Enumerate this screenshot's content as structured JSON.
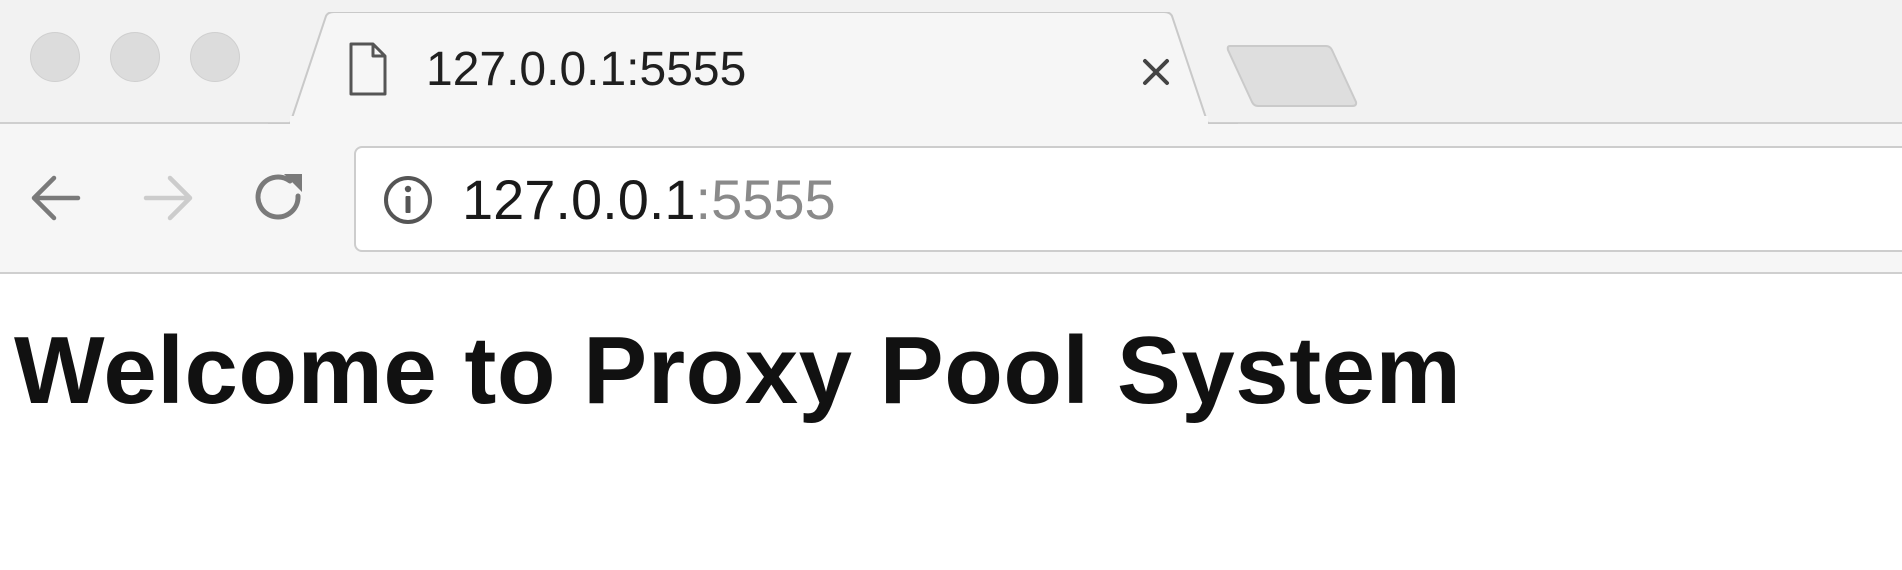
{
  "window": {
    "controls": [
      "close",
      "minimize",
      "zoom"
    ]
  },
  "tab": {
    "title": "127.0.0.1:5555",
    "icon": "document-icon",
    "close_icon": "close-icon",
    "close_symbol": "×"
  },
  "new_tab": {
    "icon": "new-tab-icon"
  },
  "toolbar": {
    "back_icon": "arrow-left-icon",
    "forward_icon": "arrow-right-icon",
    "reload_icon": "reload-icon"
  },
  "address_bar": {
    "security_icon": "info-icon",
    "host": "127.0.0.1",
    "port": ":5555"
  },
  "page": {
    "heading": "Welcome to Proxy Pool System"
  },
  "colors": {
    "chrome_bg": "#f2f2f2",
    "toolbar_bg": "#f6f6f6",
    "url_host": "#1a1a1a",
    "url_port": "#8a8a8a",
    "heading_text": "#111111"
  }
}
